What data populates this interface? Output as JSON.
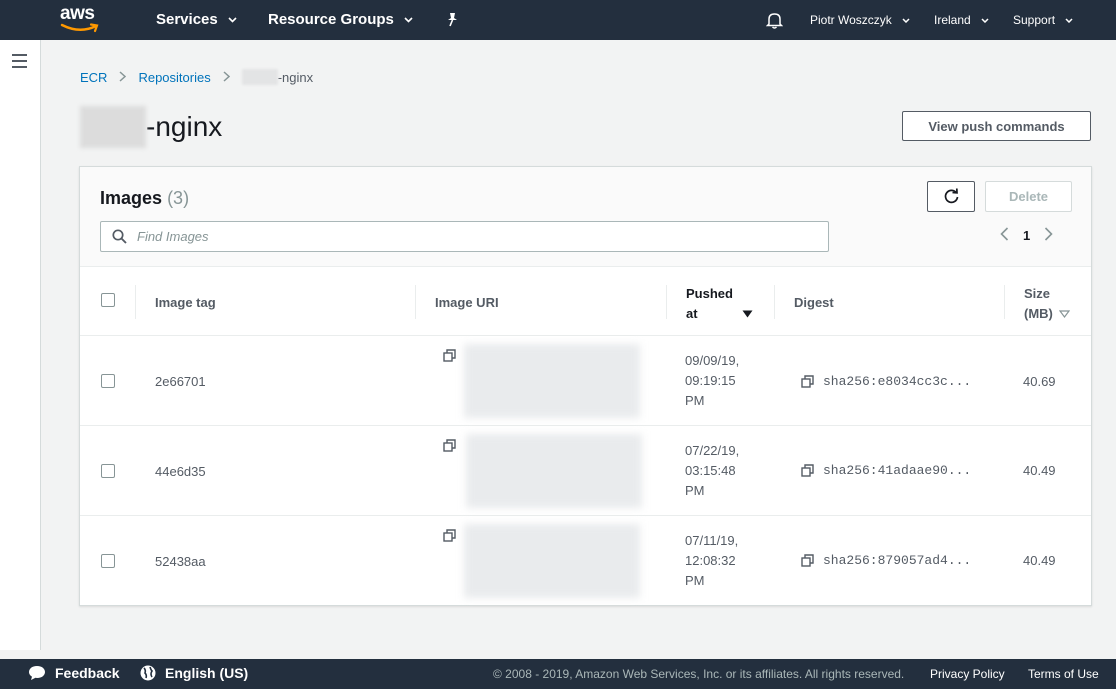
{
  "topnav": {
    "logo_text": "aws",
    "services_label": "Services",
    "resource_groups_label": "Resource Groups",
    "user_label": "Piotr Woszczyk",
    "region_label": "Ireland",
    "support_label": "Support"
  },
  "breadcrumb": {
    "items": [
      "ECR",
      "Repositories"
    ],
    "current_suffix": "-nginx"
  },
  "page": {
    "title_suffix": "-nginx",
    "push_button_label": "View push commands"
  },
  "images_panel": {
    "title": "Images",
    "count": "(3)",
    "delete_label": "Delete",
    "search_placeholder": "Find Images",
    "search_value": "",
    "current_page": "1"
  },
  "table": {
    "headers": {
      "image_tag": "Image tag",
      "image_uri": "Image URI",
      "pushed_at_line1": "Pushed",
      "pushed_at_line2": "at",
      "digest": "Digest",
      "size_line1": "Size",
      "size_line2": "(MB)"
    },
    "rows": [
      {
        "tag": "2e66701",
        "date": "09/09/19,",
        "time": "09:19:15",
        "ampm": "PM",
        "digest": "sha256:e8034cc3c...",
        "size": "40.69"
      },
      {
        "tag": "44e6d35",
        "date": "07/22/19,",
        "time": "03:15:48",
        "ampm": "PM",
        "digest": "sha256:41adaae90...",
        "size": "40.49"
      },
      {
        "tag": "52438aa",
        "date": "07/11/19,",
        "time": "12:08:32",
        "ampm": "PM",
        "digest": "sha256:879057ad4...",
        "size": "40.49"
      }
    ]
  },
  "footer": {
    "feedback_label": "Feedback",
    "language_label": "English (US)",
    "copyright": "© 2008 - 2019, Amazon Web Services, Inc. or its affiliates. All rights reserved.",
    "privacy_label": "Privacy Policy",
    "terms_label": "Terms of Use"
  },
  "colors": {
    "nav_bg": "#232f3e",
    "link": "#0073bb",
    "aws_orange": "#ff9900"
  },
  "icons": [
    "aws-smile-logo",
    "caret-down-icon",
    "pin-icon",
    "bell-icon",
    "hamburger-icon",
    "chevron-right-icon",
    "refresh-icon",
    "search-icon",
    "chevron-left-icon",
    "sort-desc-icon",
    "copy-icon",
    "speech-bubble-icon",
    "globe-icon"
  ]
}
